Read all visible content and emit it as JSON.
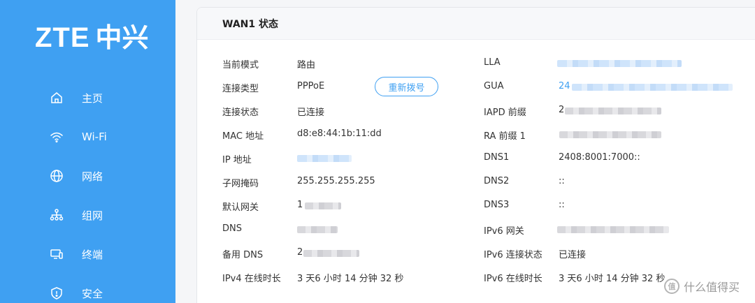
{
  "sidebar": {
    "logo_text": "ZTE",
    "logo_cn": "中兴",
    "items": [
      {
        "label": "主页",
        "icon": "home-icon"
      },
      {
        "label": "Wi-Fi",
        "icon": "wifi-icon"
      },
      {
        "label": "网络",
        "icon": "globe-icon"
      },
      {
        "label": "组网",
        "icon": "mesh-network-icon"
      },
      {
        "label": "终端",
        "icon": "devices-icon"
      },
      {
        "label": "安全",
        "icon": "shield-icon"
      }
    ]
  },
  "card": {
    "title": "WAN1 状态",
    "redial_label": "重新拨号",
    "left": [
      {
        "label": "当前模式",
        "value": "路由"
      },
      {
        "label": "连接类型",
        "value": "PPPoE"
      },
      {
        "label": "连接状态",
        "value": "已连接"
      },
      {
        "label": "MAC 地址",
        "value": "d8:e8:44:1b:11:dd"
      },
      {
        "label": "IP 地址",
        "value": ""
      },
      {
        "label": "子网掩码",
        "value": "255.255.255.255"
      },
      {
        "label": "默认网关",
        "value": "1"
      },
      {
        "label": "DNS",
        "value": ""
      },
      {
        "label": "备用 DNS",
        "value": "2"
      },
      {
        "label": "IPv4 在线时长",
        "value": "3 天6 小时 14 分钟 32 秒"
      }
    ],
    "right": [
      {
        "label": "LLA",
        "value": ""
      },
      {
        "label": "GUA",
        "value": "24"
      },
      {
        "label": "IAPD 前缀",
        "value": "2"
      },
      {
        "label": "RA 前缀 1",
        "value": ""
      },
      {
        "label": "DNS1",
        "value": "2408:8001:7000::"
      },
      {
        "label": "DNS2",
        "value": "::"
      },
      {
        "label": "DNS3",
        "value": "::"
      },
      {
        "label": "IPv6 网关",
        "value": ""
      },
      {
        "label": "IPv6 连接状态",
        "value": "已连接"
      },
      {
        "label": "IPv6 在线时长",
        "value": "3 天6 小时 14 分钟 32 秒"
      }
    ]
  },
  "watermark": {
    "badge": "值",
    "text": "什么值得买"
  }
}
